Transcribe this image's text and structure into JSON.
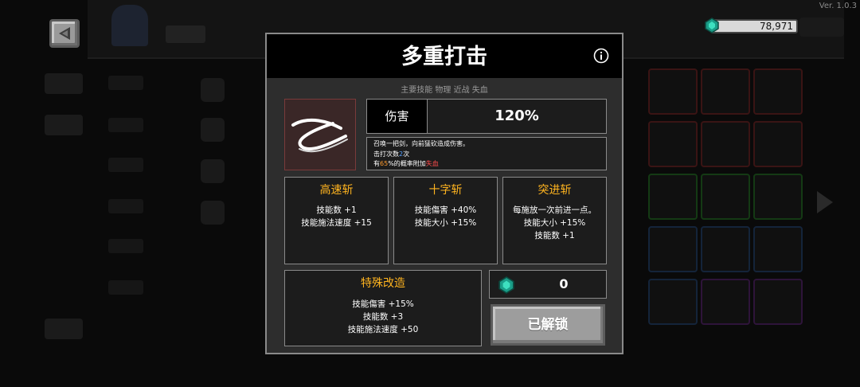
{
  "version": "Ver. 1.0.3",
  "currency": {
    "icon": "gem-icon",
    "amount": "78,971"
  },
  "modal": {
    "title": "多重打击",
    "tags": "主要技能  物理  近战  失血",
    "damage_label": "伤害",
    "damage_value": "120%",
    "desc": {
      "line1": "召唤一把剑，向前猛砍造成伤害。",
      "line2_prefix": "击打次数",
      "line2_value": "2",
      "line2_suffix": "次",
      "line3_prefix": "有",
      "line3_value": "65",
      "line3_mid": "%的概率附加",
      "line3_effect": "失血"
    },
    "cards": [
      {
        "title": "高速斩",
        "lines": [
          "技能数 +1",
          "技能施法速度 +15"
        ]
      },
      {
        "title": "十字斩",
        "lines": [
          "技能傷害 +40%",
          "技能大小 +15%"
        ]
      },
      {
        "title": "突进斩",
        "lines": [
          "每施放一次前进一点。",
          "技能大小 +15%",
          "技能数 +1"
        ]
      }
    ],
    "special": {
      "title": "特殊改造",
      "lines": [
        "技能傷害 +15%",
        "技能数 +3",
        "技能施法速度 +50"
      ]
    },
    "gem_cost": "0",
    "unlock_label": "已解锁"
  },
  "colors": {
    "accent": "#ffb41f",
    "gem": "#1fc7a5",
    "bleed": "#ff4d4d"
  }
}
